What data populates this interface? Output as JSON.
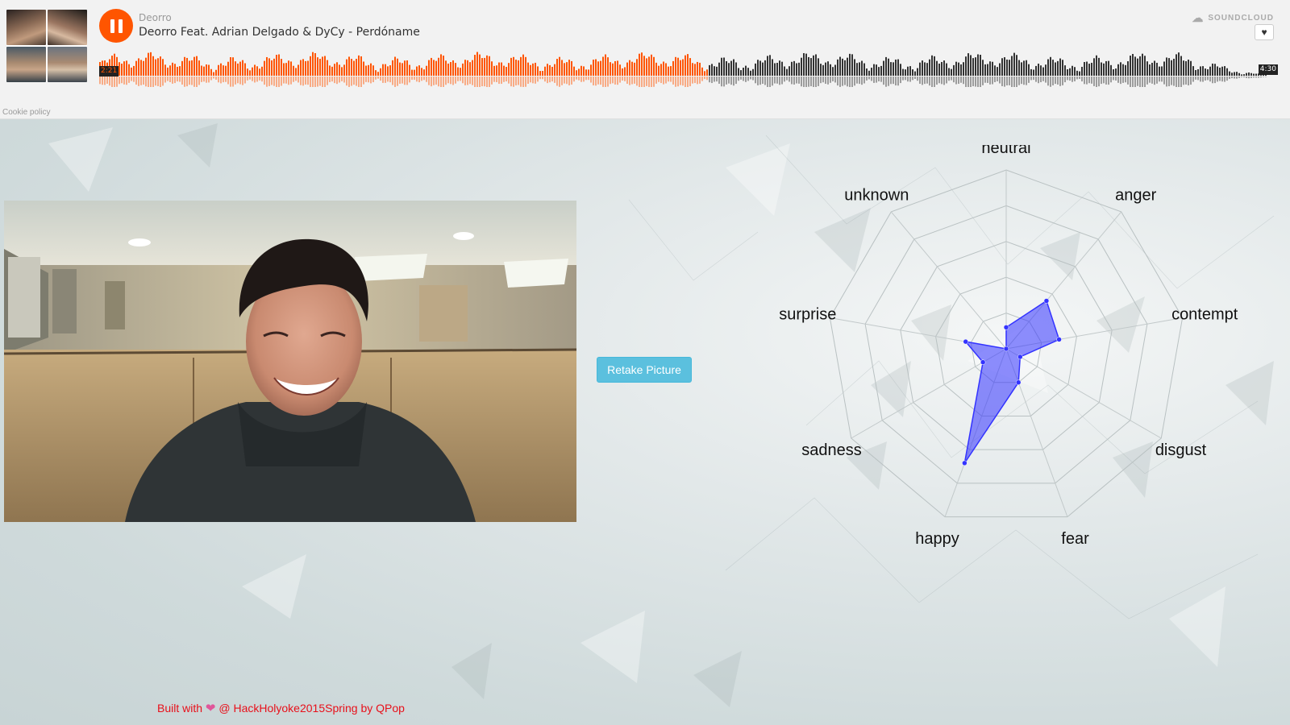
{
  "player": {
    "artist": "Deorro",
    "track_title": "Deorro Feat. Adrian Delgado & DyCy - Perdóname",
    "current_time": "2:21",
    "duration": "4:30",
    "progress": 0.522,
    "brand": "SOUNDCLOUD",
    "cookie_policy": "Cookie policy",
    "colors": {
      "played": "#ff5500",
      "unplayed": "#333333",
      "play_button": "#ff5500"
    }
  },
  "main": {
    "retake_button": "Retake Picture"
  },
  "chart_data": {
    "type": "radar",
    "axes": [
      "neutral",
      "anger",
      "contempt",
      "disgust",
      "fear",
      "happy",
      "sadness",
      "surprise",
      "unknown"
    ],
    "values": [
      0.12,
      0.35,
      0.3,
      0.09,
      0.2,
      0.68,
      0.15,
      0.23,
      0.0
    ],
    "max": 1.0,
    "levels": 5,
    "fill_color": "#3333ff",
    "grid": true
  },
  "footer": {
    "built_with": "Built with",
    "heart_icon": "heart-icon",
    "rest": "@ HackHolyoke2015Spring by QPop"
  }
}
